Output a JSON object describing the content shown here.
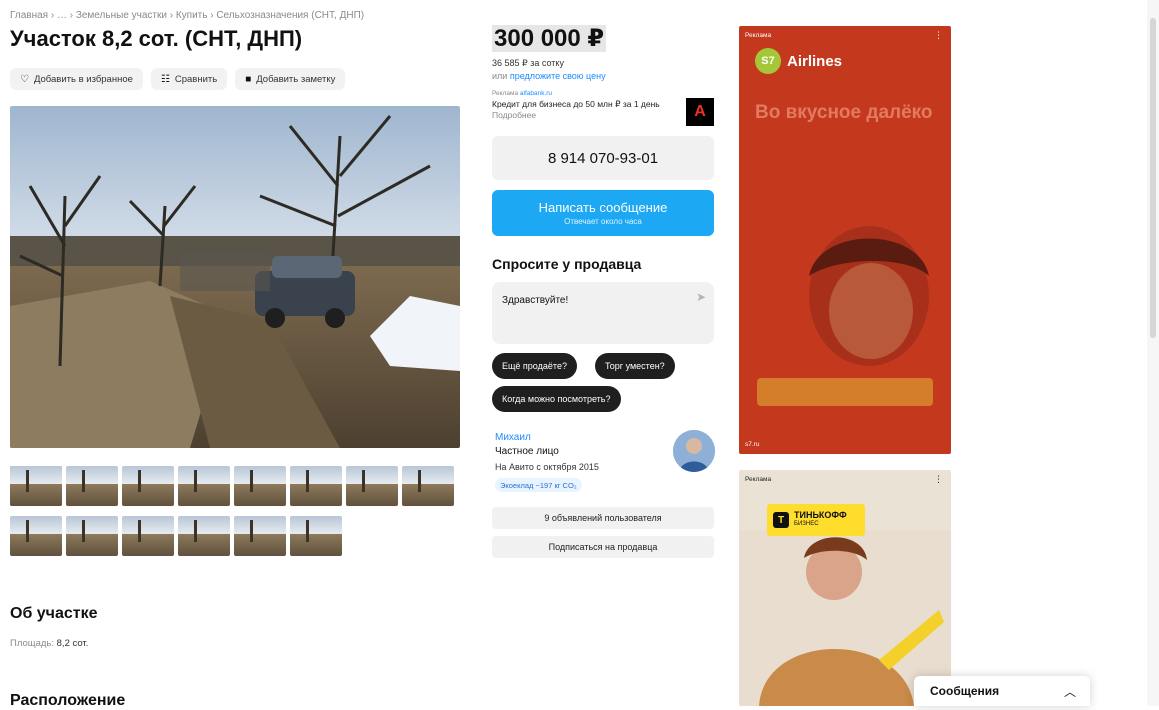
{
  "breadcrumb": "Главная › … › Земельные участки › Купить › Сельхозназначения (СНТ, ДНП)",
  "title": "Участок 8,2 сот. (СНТ, ДНП)",
  "actions": {
    "favorite": "Добавить в избранное",
    "compare": "Сравнить",
    "note": "Добавить заметку"
  },
  "about": {
    "title": "Об участке",
    "area_label": "Площадь:",
    "area_value": "8,2 сот."
  },
  "location_title": "Расположение",
  "price": {
    "value": "300 000 ₽",
    "per_sotka": "36 585 ₽ за сотку",
    "suggest_prefix": "или",
    "suggest_link": "предложите свою цену"
  },
  "mini_ad": {
    "tag": "Реклама",
    "tag_link": "alfabank.ru",
    "text": "Кредит для бизнеса до 50 млн ₽ за 1 день",
    "more": "Подробнее",
    "logo": "А"
  },
  "phone": "8 914 070-93-01",
  "message_button": {
    "label": "Написать сообщение",
    "sub": "Отвечает около часа"
  },
  "ask": {
    "title": "Спросите у продавца",
    "value": "Здравствуйте!",
    "chips": [
      "Ещё продаётe?",
      "Торг уместен?",
      "Когда можно посмотреть?"
    ]
  },
  "seller": {
    "name": "Михаил",
    "type": "Частное лицо",
    "since": "На Авито с октября 2015",
    "badge": "Экоеклад ~197 кг CO₂",
    "listings_btn": "9 объявлений пользователя",
    "subscribe_btn": "Подписаться на продавца"
  },
  "ad_s7": {
    "label": "Реклама",
    "logo": "S7",
    "brand": "Airlines",
    "headline": "Во вкусное далёко",
    "foot": "s7.ru"
  },
  "ad_tink": {
    "label": "Реклама",
    "brand": "ТИНЬКОФФ",
    "sub": "БИЗНЕС"
  },
  "messages_widget": {
    "title": "Сообщения"
  },
  "colors": {
    "link": "#1a8cff",
    "primary_button": "#1ca8f3",
    "s7_bg": "#c4391e",
    "tink_yellow": "#ffdd2d"
  },
  "icons": {
    "favorite": "heart-icon",
    "compare": "compare-icon",
    "note": "note-icon",
    "send": "send-icon",
    "chevron": "chevron-up-icon"
  }
}
